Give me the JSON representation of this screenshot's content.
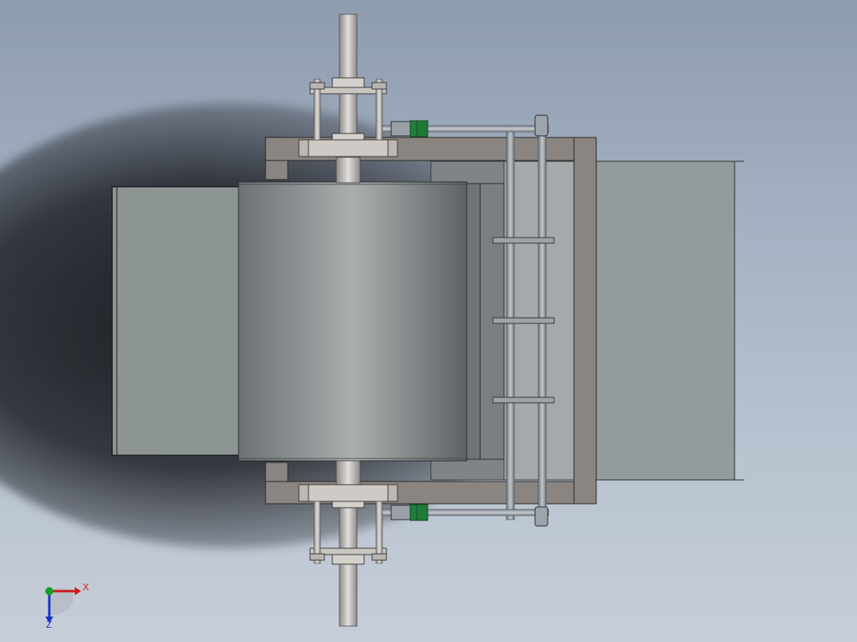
{
  "viewport": {
    "background_top": "#8e9caf",
    "background_bottom": "#c6ced9"
  },
  "model": {
    "parts": [
      "shaft",
      "roller-drum",
      "frame",
      "bearing-flange",
      "tension-rod",
      "hopper-left",
      "chute-right",
      "rake-bars"
    ],
    "colors": {
      "frame": "#8a8580",
      "plate": "#8f9594",
      "drum": "#a8aeae",
      "shaft": "#c8c4c0",
      "accent": "#1e7a3a"
    }
  },
  "triad": {
    "x_label": "X",
    "z_label": "Z",
    "x_color": "#d01818",
    "y_color": "#10a020",
    "z_color": "#1830c8"
  }
}
